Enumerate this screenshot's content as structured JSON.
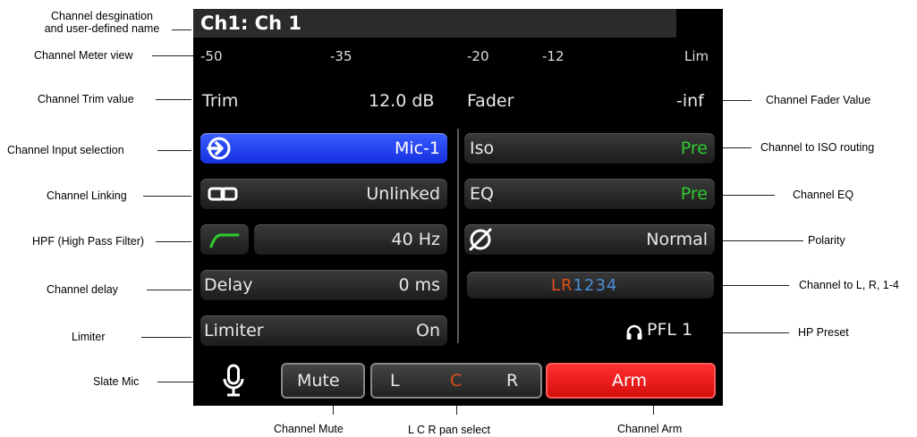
{
  "annotations": {
    "designation_line1": "Channel desgination",
    "designation_line2": "and user-defined name",
    "meter_view": "Channel Meter view",
    "trim_value": "Channel Trim value",
    "input_selection": "Channel Input selection",
    "linking": "Channel Linking",
    "hpf": "HPF (High Pass Filter)",
    "delay": "Channel delay",
    "limiter": "Limiter",
    "slate_mic": "Slate Mic",
    "fader_value": "Channel Fader Value",
    "iso_routing": "Channel to ISO routing",
    "eq": "Channel EQ",
    "polarity": "Polarity",
    "lr_routing": "Channel to L, R, 1-4",
    "hp_preset": "HP Preset",
    "mute": "Channel Mute",
    "lcr": "L C R pan select",
    "arm": "Channel Arm"
  },
  "screen": {
    "title": "Ch1: Ch 1",
    "meter_ticks": [
      "-50",
      "-35",
      "-20",
      "-12",
      "Lim"
    ],
    "trim_label": "Trim",
    "trim_value": "12.0 dB",
    "fader_label": "Fader",
    "fader_value": "-inf",
    "input_value": "Mic-1",
    "linking_value": "Unlinked",
    "hpf_value": "40 Hz",
    "delay_label": "Delay",
    "delay_value": "0 ms",
    "limiter_label": "Limiter",
    "limiter_value": "On",
    "iso_label": "Iso",
    "iso_value": "Pre",
    "eq_label": "EQ",
    "eq_value": "Pre",
    "polarity_value": "Normal",
    "routing_lr": "LR",
    "routing_nums": "1234",
    "hp_preset": "PFL 1",
    "mute_label": "Mute",
    "pan_l": "L",
    "pan_c": "C",
    "pan_r": "R",
    "arm_label": "Arm"
  },
  "colors": {
    "accent_blue": "#2a46f5",
    "pre_green": "#2ecc2e",
    "arm_red": "#e81818",
    "lr_orange": "#e0501a",
    "nums_blue": "#4a8fd8"
  },
  "icons": [
    "input-arrow-icon",
    "link-icon",
    "hpf-curve-icon",
    "polarity-icon",
    "headphones-icon",
    "microphone-icon"
  ]
}
